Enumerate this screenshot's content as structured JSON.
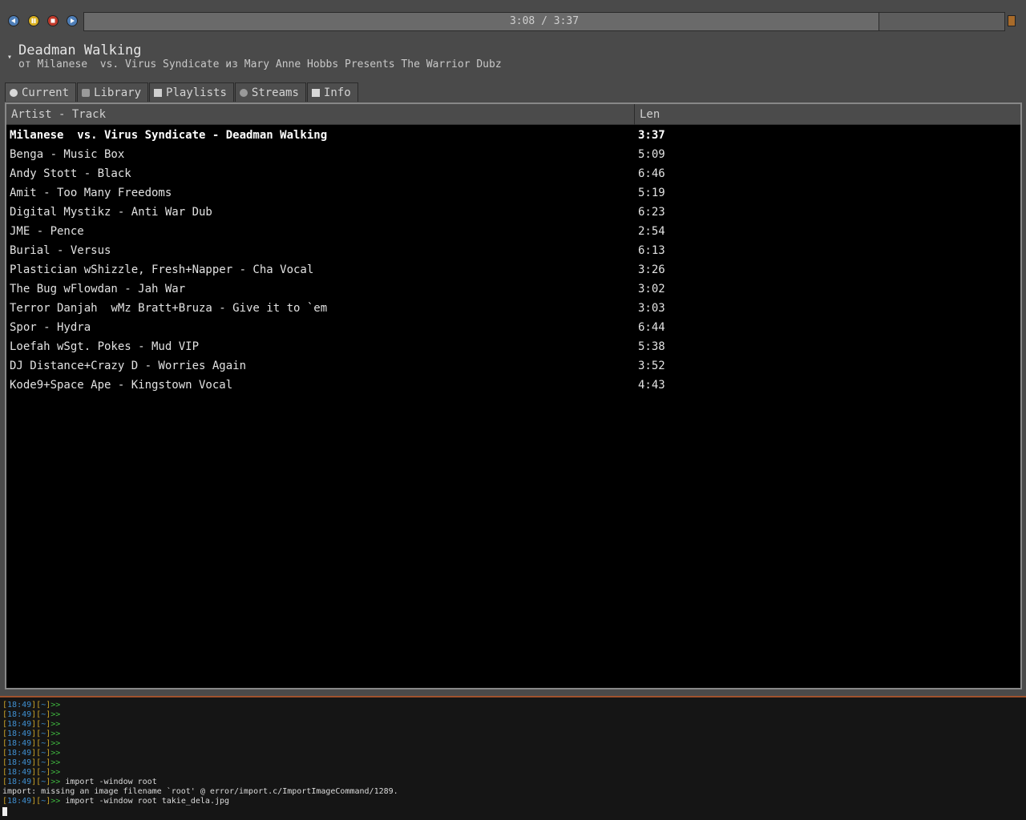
{
  "player": {
    "controls": [
      {
        "name": "previous",
        "icon": "prev-icon"
      },
      {
        "name": "pause",
        "icon": "pause-icon"
      },
      {
        "name": "stop",
        "icon": "stop-icon"
      },
      {
        "name": "next",
        "icon": "next-icon"
      }
    ],
    "time_text": "3:08 / 3:37",
    "progress_fraction": 0.864,
    "volume_icon": "volume-icon"
  },
  "now_playing": {
    "title": "Deadman Walking",
    "subtitle": "от Milanese  vs. Virus Syndicate из Mary Anne Hobbs Presents The Warrior Dubz"
  },
  "tabs": [
    {
      "label": "Current",
      "icon": "current-icon",
      "active": true
    },
    {
      "label": "Library",
      "icon": "library-icon",
      "active": false
    },
    {
      "label": "Playlists",
      "icon": "playlists-icon",
      "active": false
    },
    {
      "label": "Streams",
      "icon": "streams-icon",
      "active": false
    },
    {
      "label": "Info",
      "icon": "info-icon",
      "active": false
    }
  ],
  "playlist": {
    "columns": {
      "artist_track": "Artist - Track",
      "len": "Len"
    },
    "rows": [
      {
        "title": "Milanese  vs. Virus Syndicate - Deadman Walking",
        "len": "3:37",
        "playing": true
      },
      {
        "title": "Benga - Music Box",
        "len": "5:09"
      },
      {
        "title": "Andy Stott - Black",
        "len": "6:46"
      },
      {
        "title": "Amit - Too Many Freedoms",
        "len": "5:19"
      },
      {
        "title": "Digital Mystikz - Anti War Dub",
        "len": "6:23"
      },
      {
        "title": "JME - Pence",
        "len": "2:54"
      },
      {
        "title": "Burial - Versus",
        "len": "6:13"
      },
      {
        "title": "Plastician wShizzle, Fresh+Napper - Cha Vocal",
        "len": "3:26"
      },
      {
        "title": "The Bug wFlowdan - Jah War",
        "len": "3:02"
      },
      {
        "title": "Terror Danjah  wMz Bratt+Bruza - Give it to `em",
        "len": "3:03"
      },
      {
        "title": "Spor - Hydra",
        "len": "6:44"
      },
      {
        "title": "Loefah wSgt. Pokes - Mud VIP",
        "len": "5:38"
      },
      {
        "title": "DJ Distance+Crazy D - Worries Again",
        "len": "3:52"
      },
      {
        "title": "Kode9+Space Ape - Kingstown Vocal",
        "len": "4:43"
      }
    ]
  },
  "terminal": {
    "prompt_time": "18:49",
    "prompt_dir": "~",
    "prompt_symbol": ">>",
    "lines": [
      {
        "type": "prompt",
        "cmd": ""
      },
      {
        "type": "prompt",
        "cmd": ""
      },
      {
        "type": "prompt",
        "cmd": ""
      },
      {
        "type": "prompt",
        "cmd": ""
      },
      {
        "type": "prompt",
        "cmd": ""
      },
      {
        "type": "prompt",
        "cmd": ""
      },
      {
        "type": "prompt",
        "cmd": ""
      },
      {
        "type": "prompt",
        "cmd": ""
      },
      {
        "type": "prompt",
        "cmd": " import -window root"
      },
      {
        "type": "output",
        "text": "import: missing an image filename `root' @ error/import.c/ImportImageCommand/1289."
      },
      {
        "type": "prompt",
        "cmd": " import -window root takie_dela.jpg"
      }
    ]
  },
  "colors": {
    "accent_border": "#a0522d",
    "prompt_time": "#3f8fd0",
    "prompt_bracket": "#c9a227",
    "prompt_symbol": "#3fb83f"
  }
}
